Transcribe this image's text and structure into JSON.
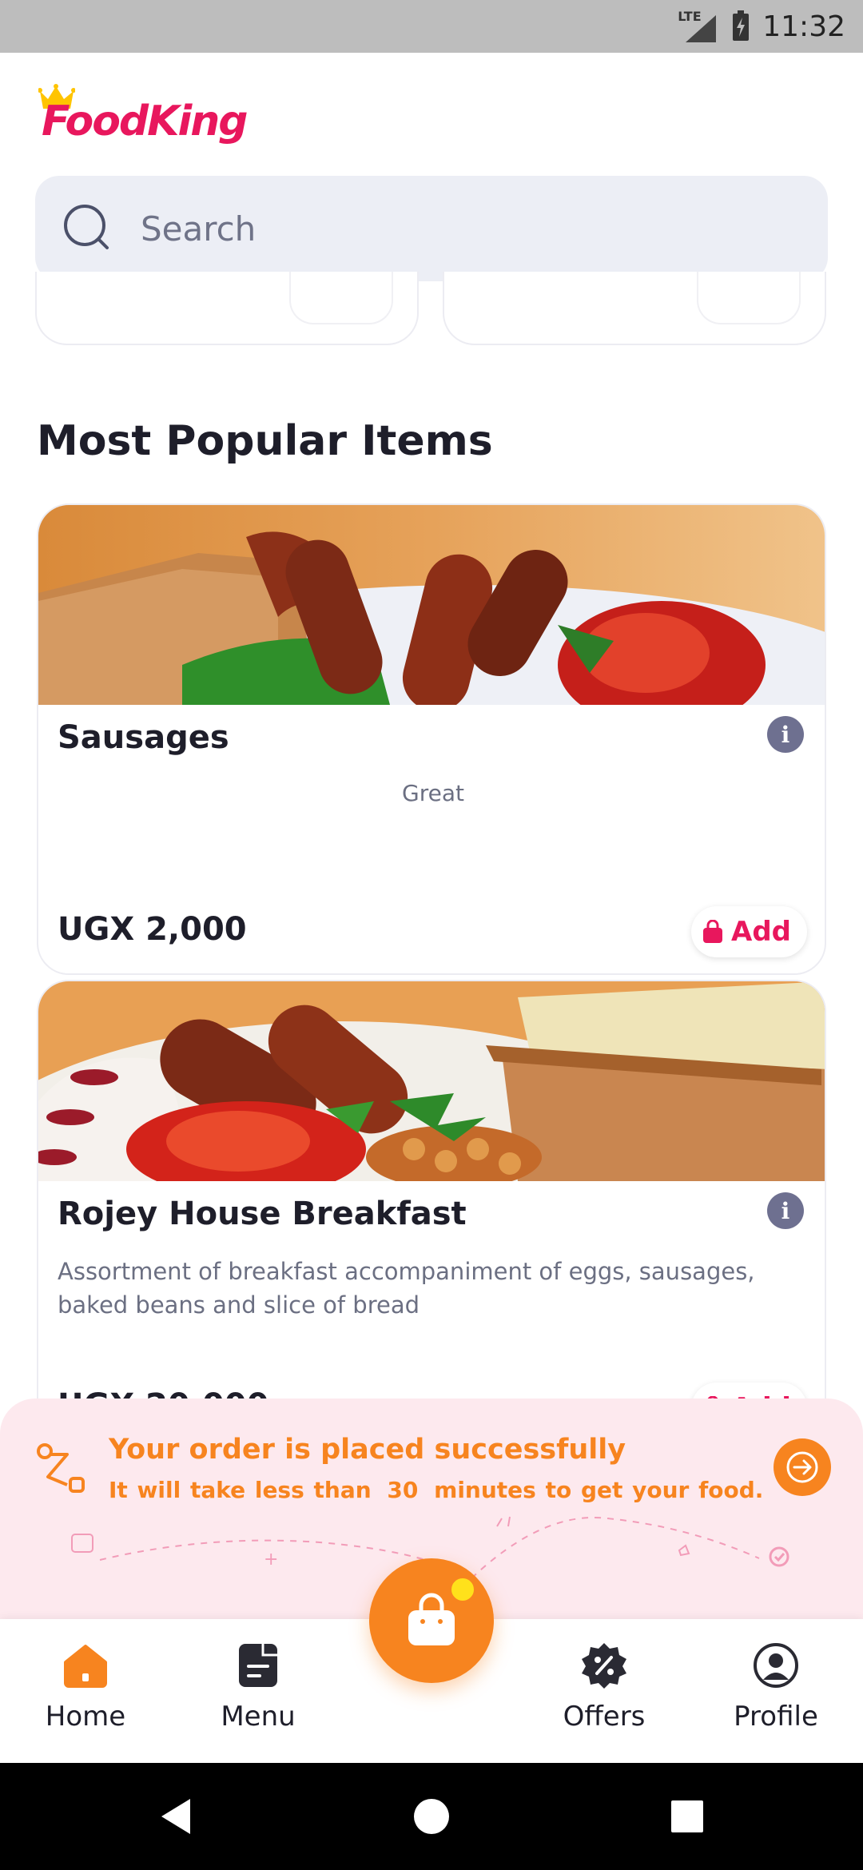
{
  "status_bar": {
    "network": "LTE",
    "time": "11:32"
  },
  "header": {
    "logo_text": "FoodKing"
  },
  "search": {
    "placeholder": "Search"
  },
  "section": {
    "title": "Most Popular Items"
  },
  "items": [
    {
      "name": "Sausages",
      "description": "Great",
      "price": "UGX 2,000",
      "add_label": "Add"
    },
    {
      "name": "Rojey House Breakfast",
      "description": "Assortment of breakfast accompaniment of eggs, sausages, baked beans and slice of bread",
      "price": "UGX 20,000",
      "add_label": "Add"
    }
  ],
  "order_banner": {
    "title": "Your order is placed successfully",
    "subtitle_prefix": "It will take less than",
    "minutes": "30",
    "subtitle_suffix": "minutes to get your food."
  },
  "bottom_nav": {
    "items": [
      {
        "label": "Home",
        "icon": "home-icon",
        "active": true
      },
      {
        "label": "Menu",
        "icon": "menu-icon",
        "active": false
      },
      {
        "label": "Offers",
        "icon": "offers-icon",
        "active": false
      },
      {
        "label": "Profile",
        "icon": "profile-icon",
        "active": false
      }
    ],
    "cart_icon": "shopping-bag-icon"
  },
  "colors": {
    "brand": "#e8175d",
    "accent": "#f7841f",
    "banner_bg": "#fde9ee",
    "search_bg": "#eceef5"
  }
}
